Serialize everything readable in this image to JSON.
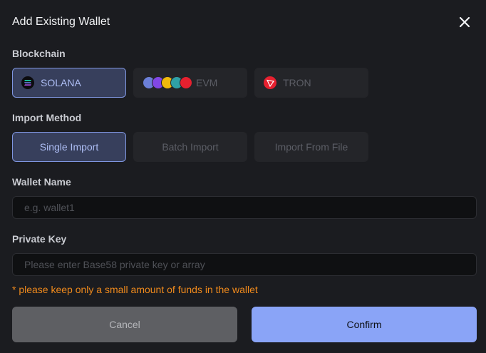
{
  "dialog": {
    "title": "Add Existing Wallet"
  },
  "blockchain": {
    "label": "Blockchain",
    "options": [
      {
        "label": "SOLANA",
        "selected": true,
        "icon": "solana-icon"
      },
      {
        "label": "EVM",
        "selected": false,
        "icon": "evm-chain-icons"
      },
      {
        "label": "TRON",
        "selected": false,
        "icon": "tron-icon"
      }
    ]
  },
  "import_method": {
    "label": "Import Method",
    "options": [
      {
        "label": "Single Import",
        "selected": true
      },
      {
        "label": "Batch Import",
        "selected": false
      },
      {
        "label": "Import From File",
        "selected": false
      }
    ]
  },
  "wallet_name": {
    "label": "Wallet Name",
    "placeholder": "e.g. wallet1",
    "value": ""
  },
  "private_key": {
    "label": "Private Key",
    "placeholder": "Please enter Base58 private key or array",
    "value": ""
  },
  "warning": "* please keep only a small amount of funds in the wallet",
  "actions": {
    "cancel": "Cancel",
    "confirm": "Confirm"
  },
  "colors": {
    "accent": "#8aa4f7",
    "selected_bg": "#373f5c",
    "warning": "#f08a1c",
    "background": "#1b1c20"
  }
}
